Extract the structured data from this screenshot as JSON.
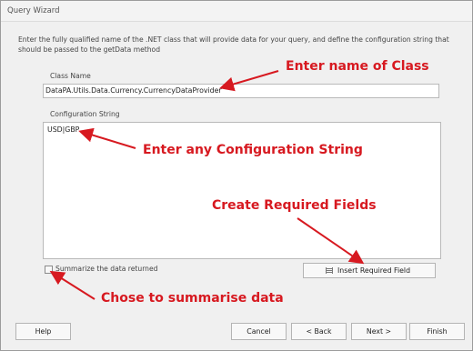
{
  "window": {
    "title": "Query Wizard"
  },
  "content": {
    "instructions": "Enter the fully qualified name of the .NET class that will provide data for your query, and define the configuration string that should be passed to the getData method",
    "class_name_label": "Class Name",
    "class_name_value": "DataPA.Utils.Data.Currency.CurrencyDataProvider",
    "config_label": "Configuration String",
    "config_value": "USD|GBP",
    "summarize_label": "Summarize the data returned",
    "summarize_checked": false,
    "insert_button_label": "Insert Required Field"
  },
  "buttons": {
    "help": "Help",
    "cancel": "Cancel",
    "back": "< Back",
    "next": "Next >",
    "finish": "Finish"
  },
  "annotations": {
    "class": "Enter name of Class",
    "config": "Enter any Configuration String",
    "fields": "Create Required Fields",
    "summary": "Chose to summarise data",
    "color": "#d71920"
  },
  "icons": {
    "insert_field": "table-insert-icon",
    "annotation_arrow": "red-arrow-icon"
  }
}
